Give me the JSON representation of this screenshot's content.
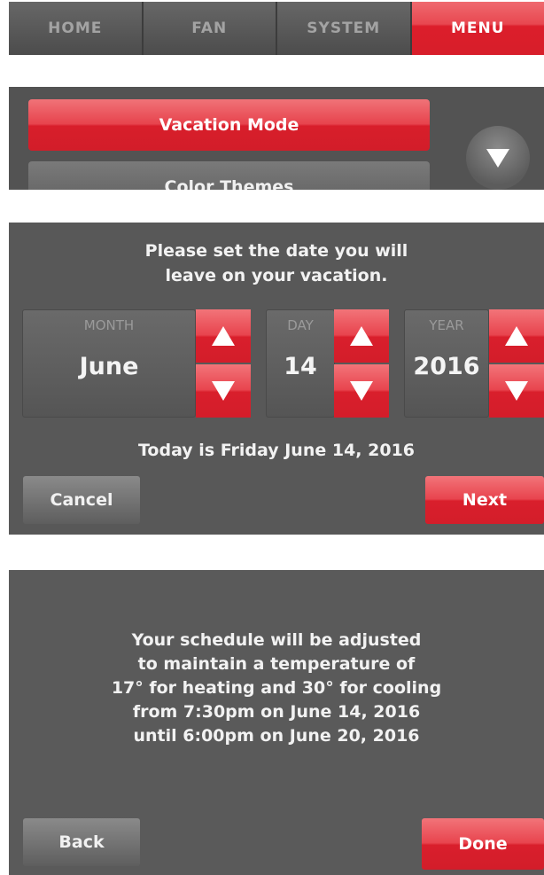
{
  "tabs": [
    {
      "label": "HOME",
      "active": false
    },
    {
      "label": "FAN",
      "active": false
    },
    {
      "label": "SYSTEM",
      "active": false
    },
    {
      "label": "MENU",
      "active": true
    }
  ],
  "menu": {
    "items": [
      "Vacation Mode",
      "Color Themes"
    ],
    "scroll_icon": "chevron-down-icon"
  },
  "date_setup": {
    "prompt_line1": "Please set the date you will",
    "prompt_line2": "leave on your vacation.",
    "month": {
      "label": "MONTH",
      "value": "June"
    },
    "day": {
      "label": "DAY",
      "value": "14"
    },
    "year": {
      "label": "YEAR",
      "value": "2016"
    },
    "today": "Today is Friday June 14, 2016",
    "cancel_label": "Cancel",
    "next_label": "Next"
  },
  "confirmation": {
    "lines": [
      "Your schedule will be adjusted",
      "to maintain a temperature of",
      "17° for heating and 30° for cooling",
      "from 7:30pm on June 14, 2016",
      "until 6:00pm on June 20, 2016"
    ],
    "back_label": "Back",
    "done_label": "Done"
  },
  "colors": {
    "accent": "#d91f2c",
    "panel": "#5a5a5a"
  }
}
